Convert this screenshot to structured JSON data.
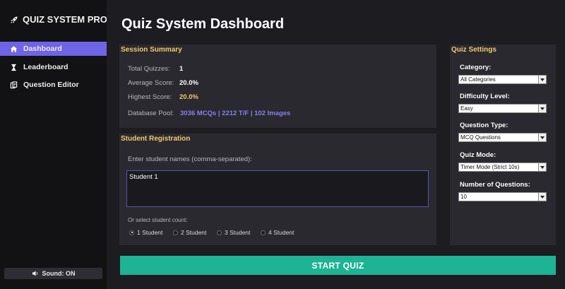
{
  "sidebar": {
    "brand": "QUIZ SYSTEM PRO",
    "items": [
      {
        "label": "Dashboard",
        "icon": "home-icon",
        "active": true
      },
      {
        "label": "Leaderboard",
        "icon": "hourglass-icon",
        "active": false
      },
      {
        "label": "Question Editor",
        "icon": "copy-icon",
        "active": false
      }
    ],
    "sound_label": "Sound: ON"
  },
  "main": {
    "title": "Quiz System Dashboard"
  },
  "summary": {
    "title": "Session Summary",
    "rows": [
      {
        "label": "Total Quizzes:",
        "value": "1"
      },
      {
        "label": "Average Score:",
        "value": "20.0%"
      },
      {
        "label": "Highest Score:",
        "value": "20.0%"
      },
      {
        "label": "Database Pool:",
        "value": "3036 MCQs | 2212 T/F | 102 Images"
      }
    ]
  },
  "registration": {
    "title": "Student Registration",
    "names_label": "Enter student names (comma-separated):",
    "names_value": "Student 1",
    "count_label": "Or select student count:",
    "options": [
      "1 Student",
      "2 Student",
      "3 Student",
      "4 Student"
    ],
    "selected_index": 0
  },
  "settings": {
    "title": "Quiz Settings",
    "category": {
      "label": "Category:",
      "value": "All Categories"
    },
    "difficulty": {
      "label": "Difficulty Level:",
      "value": "Easy"
    },
    "question_type": {
      "label": "Question Type:",
      "value": "MCQ Questions"
    },
    "quiz_mode": {
      "label": "Quiz Mode:",
      "value": "Timer Mode (Strict 10s)"
    },
    "num_questions": {
      "label": "Number of Questions:",
      "value": "10"
    }
  },
  "actions": {
    "start_label": "START QUIZ"
  },
  "colors": {
    "accent": "#6f64e6",
    "gold": "#f3c969",
    "start": "#1eb394"
  }
}
